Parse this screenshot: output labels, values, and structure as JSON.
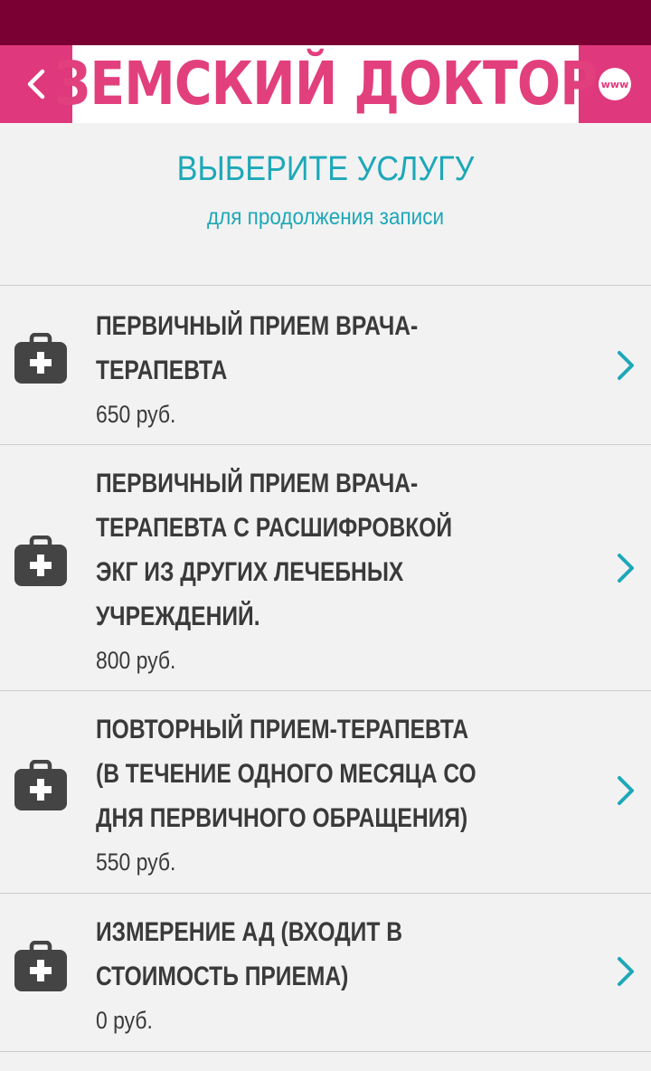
{
  "header": {
    "logo_text": "ЗЕМСКИЙ ДОКТОР",
    "www_label": "www",
    "background_color": "#e0387c",
    "status_bar_color": "#7a0033"
  },
  "page": {
    "title": "ВЫБЕРИТЕ УСЛУГУ",
    "subtitle": "для продолжения записи"
  },
  "services": [
    {
      "icon": "medical-kit-icon",
      "name_lines": [
        "ПЕРВИЧНЫЙ ПРИЕМ ВРАЧА-",
        "ТЕРАПЕВТА"
      ],
      "price": "650 руб."
    },
    {
      "icon": "medical-kit-icon",
      "name_lines": [
        "ПЕРВИЧНЫЙ ПРИЕМ ВРАЧА-",
        "ТЕРАПЕВТА С РАСШИФРОВКОЙ",
        "ЭКГ ИЗ ДРУГИХ ЛЕЧЕБНЫХ",
        "УЧРЕЖДЕНИЙ."
      ],
      "price": "800 руб."
    },
    {
      "icon": "medical-kit-icon",
      "name_lines": [
        "ПОВТОРНЫЙ ПРИЕМ-ТЕРАПЕВТА",
        "(В ТЕЧЕНИЕ ОДНОГО МЕСЯЦА СО",
        "ДНЯ ПЕРВИЧНОГО ОБРАЩЕНИЯ)"
      ],
      "price": "550 руб."
    },
    {
      "icon": "medical-kit-icon",
      "name_lines": [
        "ИЗМЕРЕНИЕ АД (ВХОДИТ В",
        "СТОИМОСТЬ ПРИЕМА)"
      ],
      "price": "0 руб."
    }
  ],
  "colors": {
    "accent": "#1da8b8",
    "text": "#3a3a3a",
    "divider": "#cccccc"
  }
}
